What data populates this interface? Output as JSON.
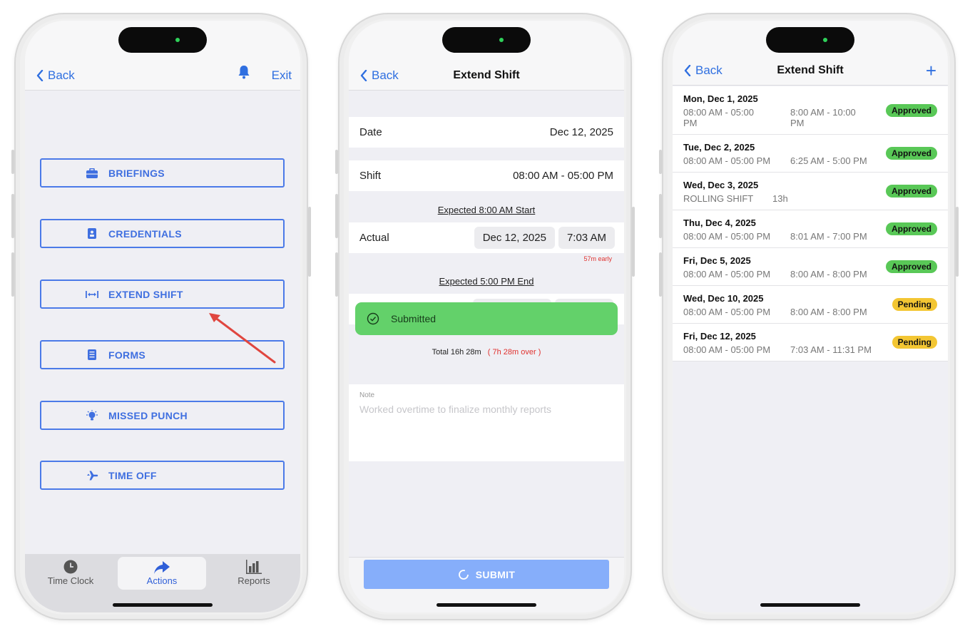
{
  "colors": {
    "accent": "#2f6fe0",
    "approved": "#59c857",
    "pending": "#f3c633",
    "toast": "#63d16a",
    "overtime": "#e0322f",
    "arrow": "#e0463f"
  },
  "phone1": {
    "nav": {
      "back": "Back",
      "exit": "Exit",
      "bell_icon": "bell-icon"
    },
    "actions": [
      {
        "label": "BRIEFINGS",
        "icon": "briefcase-icon"
      },
      {
        "label": "CREDENTIALS",
        "icon": "id-badge-icon"
      },
      {
        "label": "EXTEND SHIFT",
        "icon": "extend-arrows-icon"
      },
      {
        "label": "FORMS",
        "icon": "form-list-icon"
      },
      {
        "label": "MISSED PUNCH",
        "icon": "lightbulb-icon"
      },
      {
        "label": "TIME OFF",
        "icon": "plane-icon"
      }
    ],
    "tabs": [
      {
        "label": "Time Clock",
        "icon": "clock-icon"
      },
      {
        "label": "Actions",
        "icon": "share-arrow-icon"
      },
      {
        "label": "Reports",
        "icon": "bar-chart-icon"
      }
    ],
    "active_tab": "Actions"
  },
  "phone2": {
    "nav": {
      "back": "Back",
      "title": "Extend Shift"
    },
    "date": {
      "label": "Date",
      "value": "Dec 12, 2025"
    },
    "shift": {
      "label": "Shift",
      "value": "08:00 AM - 05:00 PM"
    },
    "expected_start": "Expected 8:00 AM Start",
    "actual": {
      "label": "Actual",
      "date": "Dec 12, 2025",
      "time": "7:03 AM",
      "note": "57m early"
    },
    "expected_end": "Expected 5:00 PM End",
    "toast": "Submitted",
    "total": {
      "text": "Total 16h 28m",
      "over": "( 7h 28m over )"
    },
    "note": {
      "label": "Note",
      "placeholder": "Worked overtime to finalize monthly reports"
    },
    "submit": "SUBMIT"
  },
  "phone3": {
    "nav": {
      "back": "Back",
      "title": "Extend Shift",
      "add": "+"
    },
    "requests": [
      {
        "date": "Mon, Dec 1, 2025",
        "shift": "08:00 AM - 05:00 PM",
        "actual": "8:00 AM - 10:00 PM",
        "status": "Approved"
      },
      {
        "date": "Tue, Dec 2, 2025",
        "shift": "08:00 AM - 05:00 PM",
        "actual": "6:25 AM - 5:00 PM",
        "status": "Approved"
      },
      {
        "date": "Wed, Dec 3, 2025",
        "shift": "ROLLING SHIFT",
        "actual": "13h",
        "status": "Approved"
      },
      {
        "date": "Thu, Dec 4, 2025",
        "shift": "08:00 AM - 05:00 PM",
        "actual": "8:01 AM - 7:00 PM",
        "status": "Approved"
      },
      {
        "date": "Fri, Dec 5, 2025",
        "shift": "08:00 AM - 05:00 PM",
        "actual": "8:00 AM - 8:00 PM",
        "status": "Approved"
      },
      {
        "date": "Wed, Dec 10, 2025",
        "shift": "08:00 AM - 05:00 PM",
        "actual": "8:00 AM - 8:00 PM",
        "status": "Pending"
      },
      {
        "date": "Fri, Dec 12, 2025",
        "shift": "08:00 AM - 05:00 PM",
        "actual": "7:03 AM - 11:31 PM",
        "status": "Pending"
      }
    ]
  }
}
